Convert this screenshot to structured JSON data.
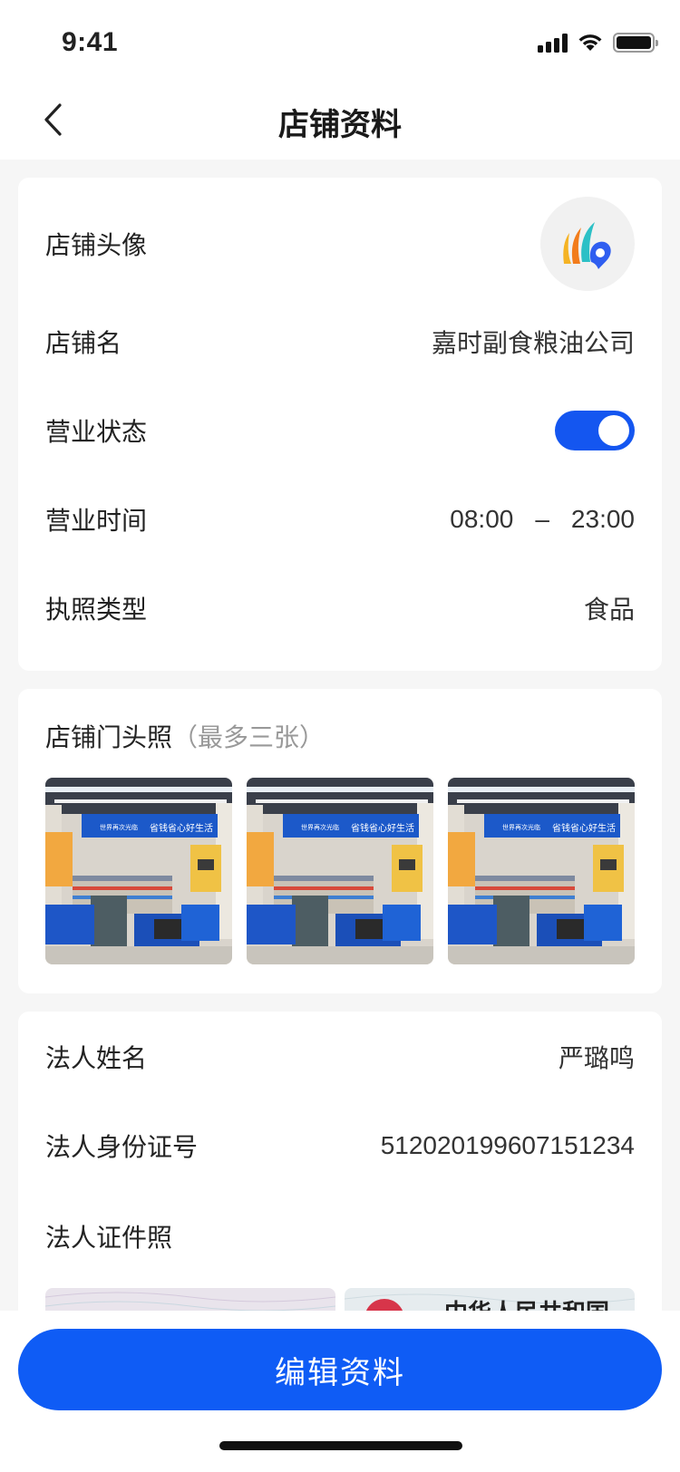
{
  "status_bar": {
    "time": "9:41"
  },
  "nav": {
    "title": "店铺资料"
  },
  "shop_info": {
    "avatar_label": "店铺头像",
    "name_label": "店铺名",
    "name_value": "嘉时副食粮油公司",
    "status_label": "营业状态",
    "status_on": true,
    "hours_label": "营业时间",
    "hours_start": "08:00",
    "hours_sep": "–",
    "hours_end": "23:00",
    "license_label": "执照类型",
    "license_value": "食品"
  },
  "storefront": {
    "title": "店铺门头照",
    "hint": "（最多三张）",
    "photos": [
      {
        "sign_text": "省钱省心好生活",
        "brand_text": "世界再次光临"
      },
      {
        "sign_text": "省钱省心好生活",
        "brand_text": "世界再次光临"
      },
      {
        "sign_text": "省钱省心好生活",
        "brand_text": "世界再次光临"
      }
    ]
  },
  "legal": {
    "name_label": "法人姓名",
    "name_value": "严璐鸣",
    "id_label": "法人身份证号",
    "id_value": "512020199607151234",
    "photo_label": "法人证件照",
    "id_back_heading": "中华人民共和国"
  },
  "footer": {
    "edit_label": "编辑资料"
  },
  "colors": {
    "accent": "#0f5cf5",
    "toggle": "#1456f0"
  }
}
